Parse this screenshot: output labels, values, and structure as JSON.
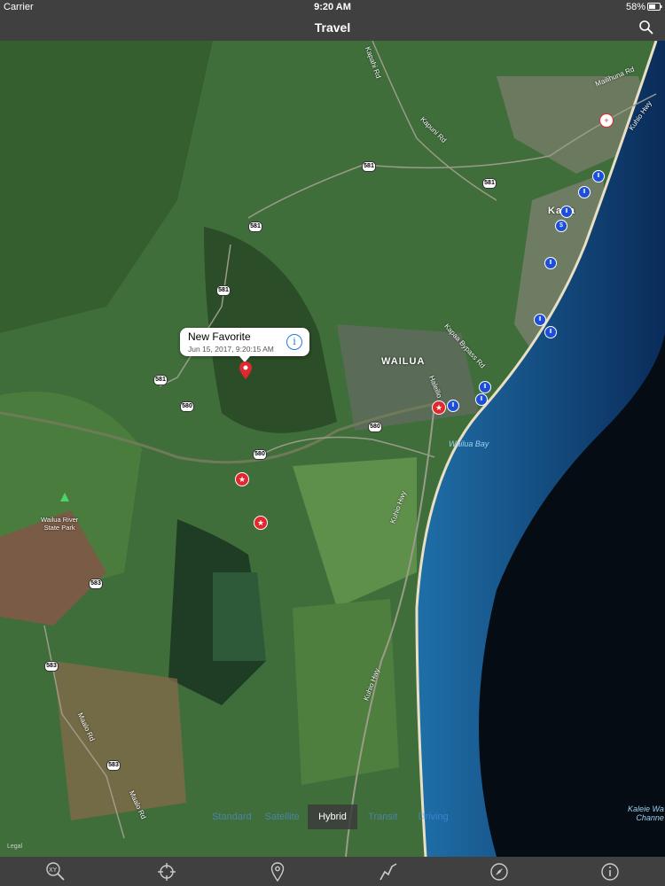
{
  "status": {
    "carrier": "Carrier",
    "time": "9:20 AM",
    "battery": "58%"
  },
  "nav": {
    "title": "Travel"
  },
  "callout": {
    "title": "New Favorite",
    "subtitle": "Jun 15, 2017, 9:20:15 AM"
  },
  "map_types": {
    "items": [
      "Standard",
      "Satellite",
      "Hybrid",
      "Transit",
      "Driving"
    ],
    "selected": "Hybrid"
  },
  "labels": {
    "wailua": "WAILUA",
    "wailua_bay": "Wailua Bay",
    "state_park": "Wailua River\nState Park",
    "kaleie": "Kaleie Wa\nChanne",
    "kapa": "Kapa",
    "kapaa_road": "Kapahi Rd",
    "kapuni_rd": "Kapuni Rd",
    "mailihuna_rd": "Mailihuna Rd",
    "kuhio_hwy_n": "Kuhio Hwy",
    "kuhio_hwy_s": "Kuhio Hwy",
    "kapaa_bypass": "Kapaa Bypass Rd",
    "haleilio": "Haleilio",
    "maalo_rd": "Maalo Rd",
    "maalo_rd2": "Maalo Rd",
    "legal": "Legal"
  },
  "shields": [
    "581",
    "581",
    "581",
    "581",
    "581",
    "580",
    "580",
    "580",
    "583",
    "583",
    "583"
  ],
  "tabs": [
    "xy-search-icon",
    "location-crosshair-icon",
    "pin-icon",
    "track-icon",
    "compass-icon",
    "info-icon"
  ]
}
